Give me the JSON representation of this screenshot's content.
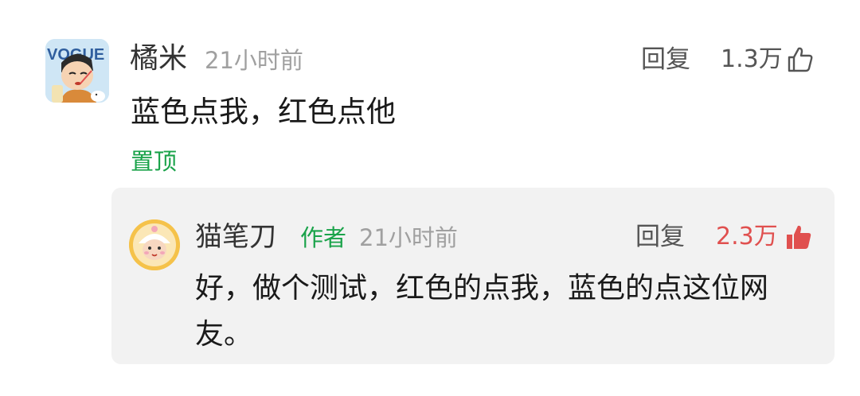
{
  "comment": {
    "username": "橘米",
    "time": "21小时前",
    "reply_label": "回复",
    "like_count": "1.3万",
    "like_state": "unliked",
    "text": "蓝色点我，红色点他",
    "pinned_label": "置顶",
    "avatar_text": "VOGUE"
  },
  "reply": {
    "username": "猫笔刀",
    "author_badge": "作者",
    "time": "21小时前",
    "reply_label": "回复",
    "like_count": "2.3万",
    "like_state": "liked",
    "text": "好，做个测试，红色的点我，蓝色的点这位网友。"
  },
  "colors": {
    "accent_green": "#1aa34a",
    "liked_red": "#e0504f",
    "muted_gray": "#a0a0a0",
    "reply_bg": "#f2f2f2"
  },
  "icons": {
    "like_unliked": "thumbs-up-outline-icon",
    "like_liked": "thumbs-up-filled-icon"
  }
}
